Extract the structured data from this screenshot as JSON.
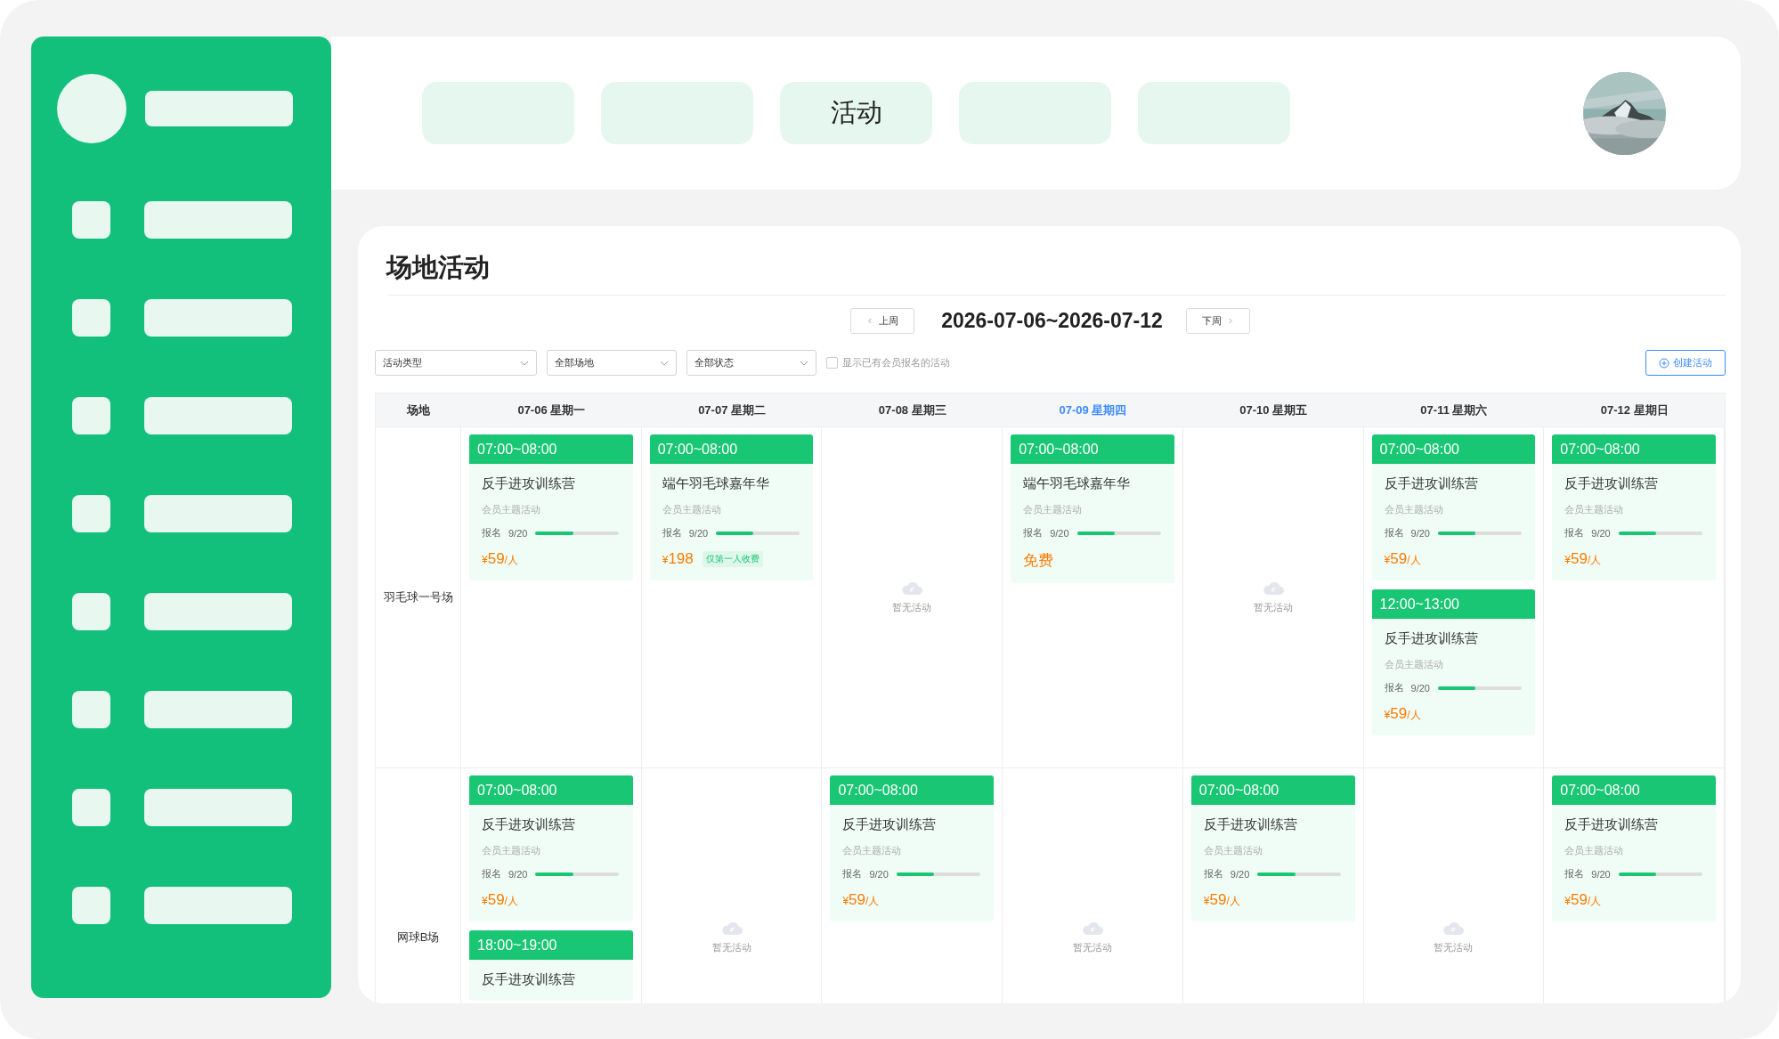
{
  "nav": [
    {
      "kind": "placeholder"
    },
    {
      "kind": "placeholder"
    },
    {
      "kind": "tab",
      "label": "活动"
    },
    {
      "kind": "placeholder"
    },
    {
      "kind": "placeholder"
    }
  ],
  "page": {
    "title": "场地活动",
    "prev_week": "上周",
    "date_range": "2026-07-06~2026-07-12",
    "next_week": "下周"
  },
  "filters": [
    {
      "value": "活动类型"
    },
    {
      "value": "全部场地"
    },
    {
      "value": "全部状态"
    }
  ],
  "member_checkbox": {
    "label": "显示已有会员报名的活动",
    "checked": false
  },
  "create_button": "创建活动",
  "table": {
    "corner": "场地",
    "days": [
      {
        "label": "07-06 星期一",
        "today": false
      },
      {
        "label": "07-07 星期二",
        "today": false
      },
      {
        "label": "07-08 星期三",
        "today": false
      },
      {
        "label": "07-09 星期四",
        "today": true
      },
      {
        "label": "07-10 星期五",
        "today": false
      },
      {
        "label": "07-11 星期六",
        "today": false
      },
      {
        "label": "07-12 星期日",
        "today": false
      }
    ],
    "rows": [
      {
        "venue": "羽毛球一号场",
        "cells": [
          {
            "events": [
              {
                "time": "07:00~08:00",
                "title": "反手进攻训练营",
                "subtitle": "会员主题活动",
                "signup_label": "报名",
                "signup_count": "9/20",
                "level": 0.45,
                "price": {
                  "currency": "¥",
                  "amount": "59",
                  "unit": "/人"
                }
              }
            ]
          },
          {
            "events": [
              {
                "time": "07:00~08:00",
                "title": "端午羽毛球嘉年华",
                "subtitle": "会员主题活动",
                "signup_label": "报名",
                "signup_count": "9/20",
                "level": 0.45,
                "price": {
                  "currency": "¥",
                  "amount": "198",
                  "tag": "仅第一人收费"
                }
              }
            ]
          },
          {
            "empty_text": "暂无活动"
          },
          {
            "events": [
              {
                "time": "07:00~08:00",
                "title": "端午羽毛球嘉年华",
                "subtitle": "会员主题活动",
                "signup_label": "报名",
                "signup_count": "9/20",
                "level": 0.45,
                "price": {
                  "amount": "免费"
                }
              }
            ]
          },
          {
            "empty_text": "暂无活动"
          },
          {
            "events": [
              {
                "time": "07:00~08:00",
                "title": "反手进攻训练营",
                "subtitle": "会员主题活动",
                "signup_label": "报名",
                "signup_count": "9/20",
                "level": 0.45,
                "price": {
                  "currency": "¥",
                  "amount": "59",
                  "unit": "/人"
                }
              },
              {
                "time": "12:00~13:00",
                "title": "反手进攻训练营",
                "subtitle": "会员主题活动",
                "signup_label": "报名",
                "signup_count": "9/20",
                "level": 0.45,
                "price": {
                  "currency": "¥",
                  "amount": "59",
                  "unit": "/人"
                }
              }
            ]
          },
          {
            "events": [
              {
                "time": "07:00~08:00",
                "title": "反手进攻训练营",
                "subtitle": "会员主题活动",
                "signup_label": "报名",
                "signup_count": "9/20",
                "level": 0.45,
                "price": {
                  "currency": "¥",
                  "amount": "59",
                  "unit": "/人"
                }
              }
            ]
          }
        ]
      },
      {
        "venue": "网球B场",
        "cells": [
          {
            "events": [
              {
                "time": "07:00~08:00",
                "title": "反手进攻训练营",
                "subtitle": "会员主题活动",
                "signup_label": "报名",
                "signup_count": "9/20",
                "level": 0.45,
                "price": {
                  "currency": "¥",
                  "amount": "59",
                  "unit": "/人"
                }
              },
              {
                "time": "18:00~19:00",
                "title": "反手进攻训练营"
              }
            ]
          },
          {
            "empty_text": "暂无活动"
          },
          {
            "events": [
              {
                "time": "07:00~08:00",
                "title": "反手进攻训练营",
                "subtitle": "会员主题活动",
                "signup_label": "报名",
                "signup_count": "9/20",
                "level": 0.45,
                "price": {
                  "currency": "¥",
                  "amount": "59",
                  "unit": "/人"
                }
              }
            ]
          },
          {
            "empty_text": "暂无活动"
          },
          {
            "events": [
              {
                "time": "07:00~08:00",
                "title": "反手进攻训练营",
                "subtitle": "会员主题活动",
                "signup_label": "报名",
                "signup_count": "9/20",
                "level": 0.45,
                "price": {
                  "currency": "¥",
                  "amount": "59",
                  "unit": "/人"
                }
              }
            ]
          },
          {
            "empty_text": "暂无活动"
          },
          {
            "events": [
              {
                "time": "07:00~08:00",
                "title": "反手进攻训练营",
                "subtitle": "会员主题活动",
                "signup_label": "报名",
                "signup_count": "9/20",
                "level": 0.45,
                "price": {
                  "currency": "¥",
                  "amount": "59",
                  "unit": "/人"
                }
              }
            ]
          }
        ]
      }
    ]
  }
}
